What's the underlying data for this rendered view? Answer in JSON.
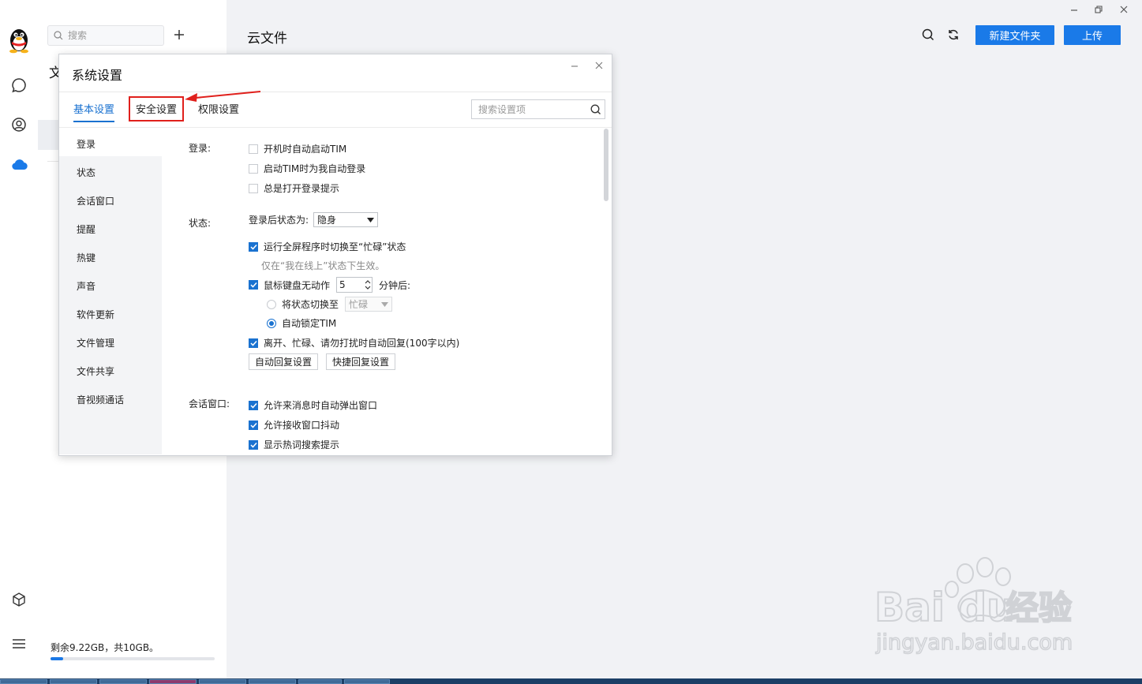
{
  "app": {
    "section_title": "云文件",
    "search_placeholder": "搜索",
    "peek_label": "文",
    "storage_text": "剩余9.22GB，共10GB。",
    "storage_used_fraction": 0.078,
    "new_folder_label": "新建文件夹",
    "upload_label": "上传"
  },
  "rail_icons": [
    "qq-penguin-icon",
    "chat-icon",
    "contacts-icon",
    "cloud-icon",
    "cube-icon",
    "menu-icon"
  ],
  "dialog": {
    "title": "系统设置",
    "tabs": [
      {
        "label": "基本设置",
        "active": true
      },
      {
        "label": "安全设置",
        "active": false,
        "highlighted": true
      },
      {
        "label": "权限设置",
        "active": false
      }
    ],
    "search_placeholder": "搜索设置项",
    "sidebar": [
      "登录",
      "状态",
      "会话窗口",
      "提醒",
      "热键",
      "声音",
      "软件更新",
      "文件管理",
      "文件共享",
      "音视频通话"
    ],
    "sections": {
      "login": {
        "label": "登录:",
        "options": [
          {
            "label": "开机时自动启动TIM",
            "checked": false
          },
          {
            "label": "启动TIM时为我自动登录",
            "checked": false
          },
          {
            "label": "总是打开登录提示",
            "checked": false
          }
        ]
      },
      "status": {
        "label": "状态:",
        "after_login_label": "登录后状态为:",
        "after_login_value": "隐身",
        "fullscreen_busy": {
          "label": "运行全屏程序时切换至“忙碌”状态",
          "checked": true
        },
        "fullscreen_note": "仅在“我在线上”状态下生效。",
        "idle": {
          "label": "鼠标键盘无动作",
          "checked": true,
          "minutes": "5",
          "suffix": "分钟后:"
        },
        "switch_status": {
          "label": "将状态切换至",
          "checked": false,
          "value": "忙碌"
        },
        "auto_lock": {
          "label": "自动锁定TIM",
          "checked": true
        },
        "auto_reply": {
          "label": "离开、忙碌、请勿打扰时自动回复(100字以内)",
          "checked": true
        },
        "auto_reply_btn": "自动回复设置",
        "quick_reply_btn": "快捷回复设置"
      },
      "chat": {
        "label": "会话窗口:",
        "options": [
          {
            "label": "允许来消息时自动弹出窗口",
            "checked": true
          },
          {
            "label": "允许接收窗口抖动",
            "checked": true
          },
          {
            "label": "显示热词搜索提示",
            "checked": true
          }
        ]
      }
    }
  },
  "watermark": {
    "brand": "Bai du",
    "brand_cn": "经验",
    "url": "jingyan.baidu.com"
  },
  "colors": {
    "accent": "#1a7ae8",
    "highlight_box": "#e0201c",
    "active_tab": "#1a72d0"
  }
}
